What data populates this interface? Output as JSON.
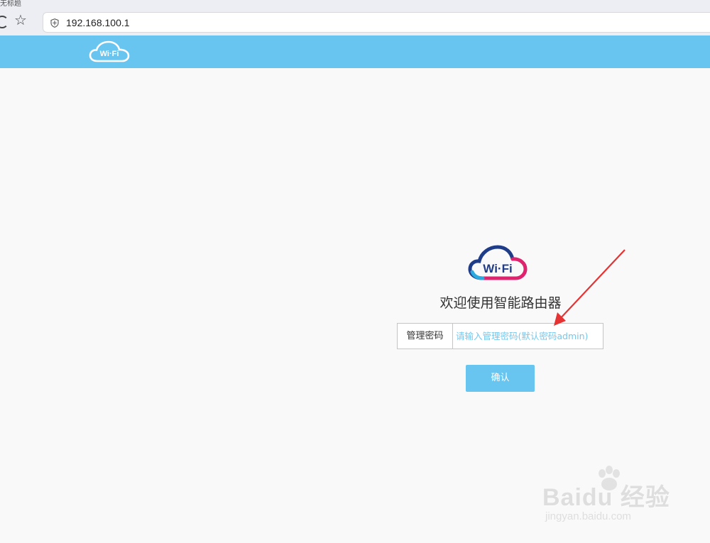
{
  "browser": {
    "tab_fragment": "无标题",
    "url": "192.168.100.1"
  },
  "header": {
    "logo_text": "Wi·Fi"
  },
  "login": {
    "logo_text": "Wi·Fi",
    "welcome": "欢迎使用智能路由器",
    "password_label": "管理密码",
    "password_placeholder": "请输入管理密码(默认密码admin)",
    "password_value": "",
    "confirm_label": "确认"
  },
  "watermark": {
    "main": "Baidu 经验",
    "sub": "jingyan.baidu.com"
  },
  "colors": {
    "header_bg": "#68c5f0",
    "button_bg": "#68c5f0",
    "input_border": "#9ad3ef",
    "arrow": "#e53333",
    "logo_blue": "#1f3c88",
    "logo_pink": "#e0236f"
  }
}
